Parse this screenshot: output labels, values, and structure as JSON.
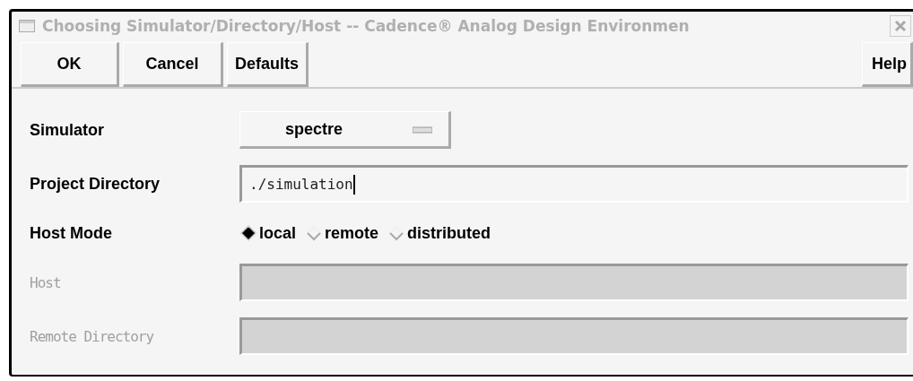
{
  "window": {
    "title": "Choosing Simulator/Directory/Host -- Cadence® Analog Design Environmen"
  },
  "buttons": [
    {
      "label": "OK"
    },
    {
      "label": "Cancel"
    },
    {
      "label": "Defaults"
    }
  ],
  "help_button": {
    "label": "Help"
  },
  "fields": [
    {
      "kind": "dropdown",
      "label": "Simulator",
      "value": "spectre",
      "disabled": false
    },
    {
      "kind": "text",
      "label": "Project Directory",
      "value": "./simulation",
      "disabled": false
    },
    {
      "kind": "radio",
      "label": "Host Mode",
      "disabled": false,
      "options": [
        {
          "label": "local",
          "selected": true
        },
        {
          "label": "remote",
          "selected": false
        },
        {
          "label": "distributed",
          "selected": false
        }
      ]
    },
    {
      "kind": "text",
      "label": "Host",
      "disabled": true
    },
    {
      "kind": "text",
      "label": "Remote Directory",
      "disabled": true
    }
  ]
}
